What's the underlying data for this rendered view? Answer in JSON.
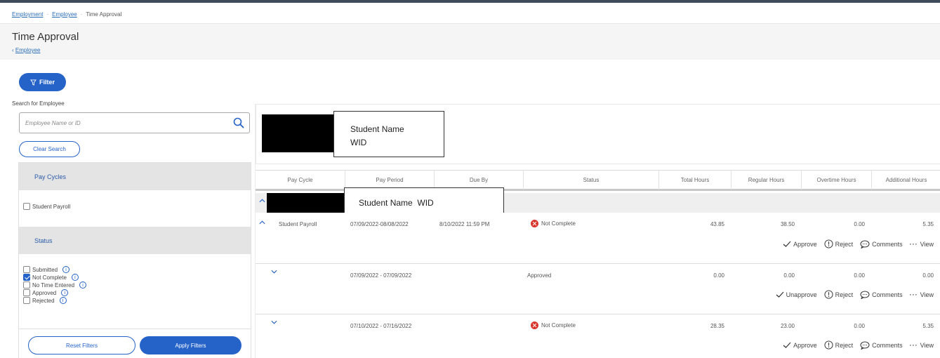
{
  "breadcrumb": {
    "items": [
      "Employment",
      "Employee",
      "Time Approval"
    ]
  },
  "page": {
    "title": "Time Approval",
    "back_label": "Employee"
  },
  "filter": {
    "button_label": "Filter"
  },
  "search": {
    "label": "Search for Employee",
    "placeholder": "Employee Name or ID",
    "clear_label": "Clear Search"
  },
  "sidebar": {
    "pay_cycles": {
      "heading": "Pay Cycles",
      "options": [
        {
          "label": "Student Payroll",
          "checked": false
        }
      ]
    },
    "status": {
      "heading": "Status",
      "options": [
        {
          "label": "Submitted",
          "checked": false
        },
        {
          "label": "Not Complete",
          "checked": true
        },
        {
          "label": "No Time Entered",
          "checked": false
        },
        {
          "label": "Approved",
          "checked": false
        },
        {
          "label": "Rejected",
          "checked": false
        }
      ]
    },
    "reset_label": "Reset Filters",
    "apply_label": "Apply Filters"
  },
  "employee_card": {
    "name_line": "Student Name",
    "id_line": "WID"
  },
  "group": {
    "label": "Student Name  WID"
  },
  "table": {
    "columns": [
      "Pay Cycle",
      "Pay Period",
      "Due By",
      "Status",
      "Total Hours",
      "Regular Hours",
      "Overtime Hours",
      "Additional Hours"
    ],
    "rows": [
      {
        "pay_cycle": "Student Payroll",
        "pay_period": "07/09/2022-08/08/2022",
        "due_by": "8/10/2022 11:59 PM",
        "status": "Not Complete",
        "total": "43.85",
        "regular": "38.50",
        "overtime": "0.00",
        "additional": "5.35",
        "approve_label": "Approve"
      },
      {
        "pay_cycle": "",
        "pay_period": "07/09/2022 - 07/09/2022",
        "due_by": "",
        "status": "Approved",
        "total": "0.00",
        "regular": "0.00",
        "overtime": "0.00",
        "additional": "0.00",
        "approve_label": "Unapprove"
      },
      {
        "pay_cycle": "",
        "pay_period": "07/10/2022 - 07/16/2022",
        "due_by": "",
        "status": "Not Complete",
        "total": "28.35",
        "regular": "23.00",
        "overtime": "0.00",
        "additional": "5.35",
        "approve_label": "Approve"
      }
    ],
    "action_labels": {
      "reject": "Reject",
      "comments": "Comments",
      "view": "View"
    }
  },
  "colors": {
    "accent": "#2563c8",
    "error": "#d9342b",
    "panel_gray": "#e4e4e4"
  }
}
